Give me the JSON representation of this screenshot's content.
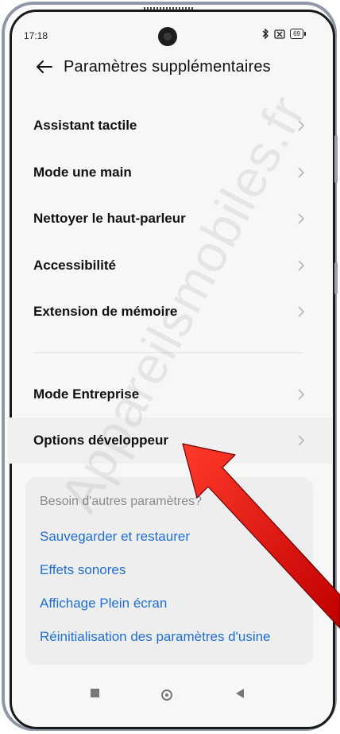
{
  "status_bar": {
    "time": "17:18",
    "battery": "69",
    "icons": [
      "bluetooth-icon",
      "sim-off-icon",
      "battery-icon"
    ]
  },
  "header": {
    "back_icon": "arrow-left-icon",
    "title": "Paramètres supplémentaires"
  },
  "settings": {
    "group1": [
      {
        "label": "Assistant tactile"
      },
      {
        "label": "Mode une main"
      },
      {
        "label": "Nettoyer le haut-parleur"
      },
      {
        "label": "Accessibilité"
      },
      {
        "label": "Extension de mémoire"
      }
    ],
    "group2": [
      {
        "label": "Mode Entreprise"
      },
      {
        "label": "Options développeur",
        "highlighted": true
      }
    ]
  },
  "suggestions": {
    "question": "Besoin d'autres paramètres?",
    "links": [
      "Sauvegarder et restaurer",
      "Effets sonores",
      "Affichage Plein écran",
      "Réinitialisation des paramètres d'usine"
    ]
  },
  "nav_bar": [
    "recents-square-icon",
    "home-circle-icon",
    "back-triangle-icon"
  ],
  "watermark": "Appareilsmobiles.fr",
  "colors": {
    "link": "#1f6fd6",
    "arrow": "#e01010",
    "highlight": "#f0f0f0"
  }
}
